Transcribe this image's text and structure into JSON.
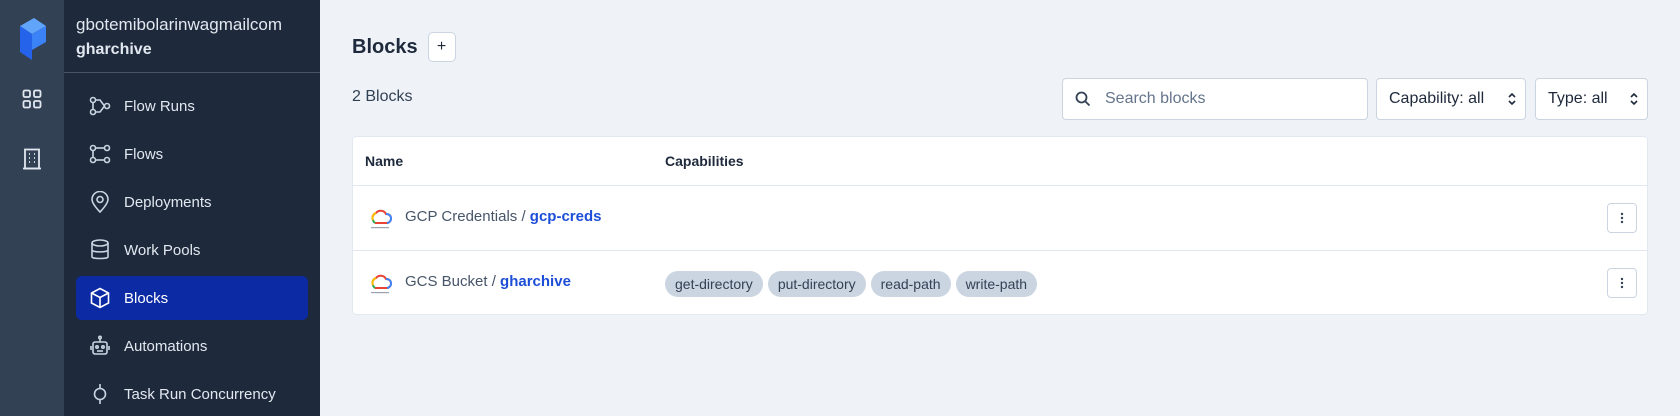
{
  "rail": {
    "icons": [
      "prefect-logo-icon",
      "dashboard-grid-icon",
      "building-icon"
    ]
  },
  "sidebar": {
    "account": "gbotemibolarinwagmailcom",
    "workspace": "gharchive",
    "items": [
      {
        "label": "Flow Runs",
        "icon": "flow-runs-icon",
        "active": false
      },
      {
        "label": "Flows",
        "icon": "flows-icon",
        "active": false
      },
      {
        "label": "Deployments",
        "icon": "map-pin-icon",
        "active": false
      },
      {
        "label": "Work Pools",
        "icon": "database-icon",
        "active": false
      },
      {
        "label": "Blocks",
        "icon": "cube-icon",
        "active": true
      },
      {
        "label": "Automations",
        "icon": "robot-icon",
        "active": false
      },
      {
        "label": "Task Run Concurrency",
        "icon": "concurrency-icon",
        "active": false
      }
    ]
  },
  "main": {
    "title": "Blocks",
    "add_label": "+",
    "count": "2 Blocks",
    "search_placeholder": "Search blocks",
    "capability_filter": "Capability: all",
    "type_filter": "Type: all",
    "table": {
      "headers": [
        "Name",
        "Capabilities"
      ],
      "rows": [
        {
          "type": "GCP Credentials",
          "sep": " / ",
          "slug": "gcp-creds",
          "capabilities": []
        },
        {
          "type": "GCS Bucket",
          "sep": " / ",
          "slug": "gharchive",
          "capabilities": [
            "get-directory",
            "put-directory",
            "read-path",
            "write-path"
          ]
        }
      ]
    }
  },
  "colors": {
    "accent": "#0b2aa3",
    "link": "#1d4ed8",
    "sidebar_bg": "#1e293b",
    "rail_bg": "#334155"
  }
}
